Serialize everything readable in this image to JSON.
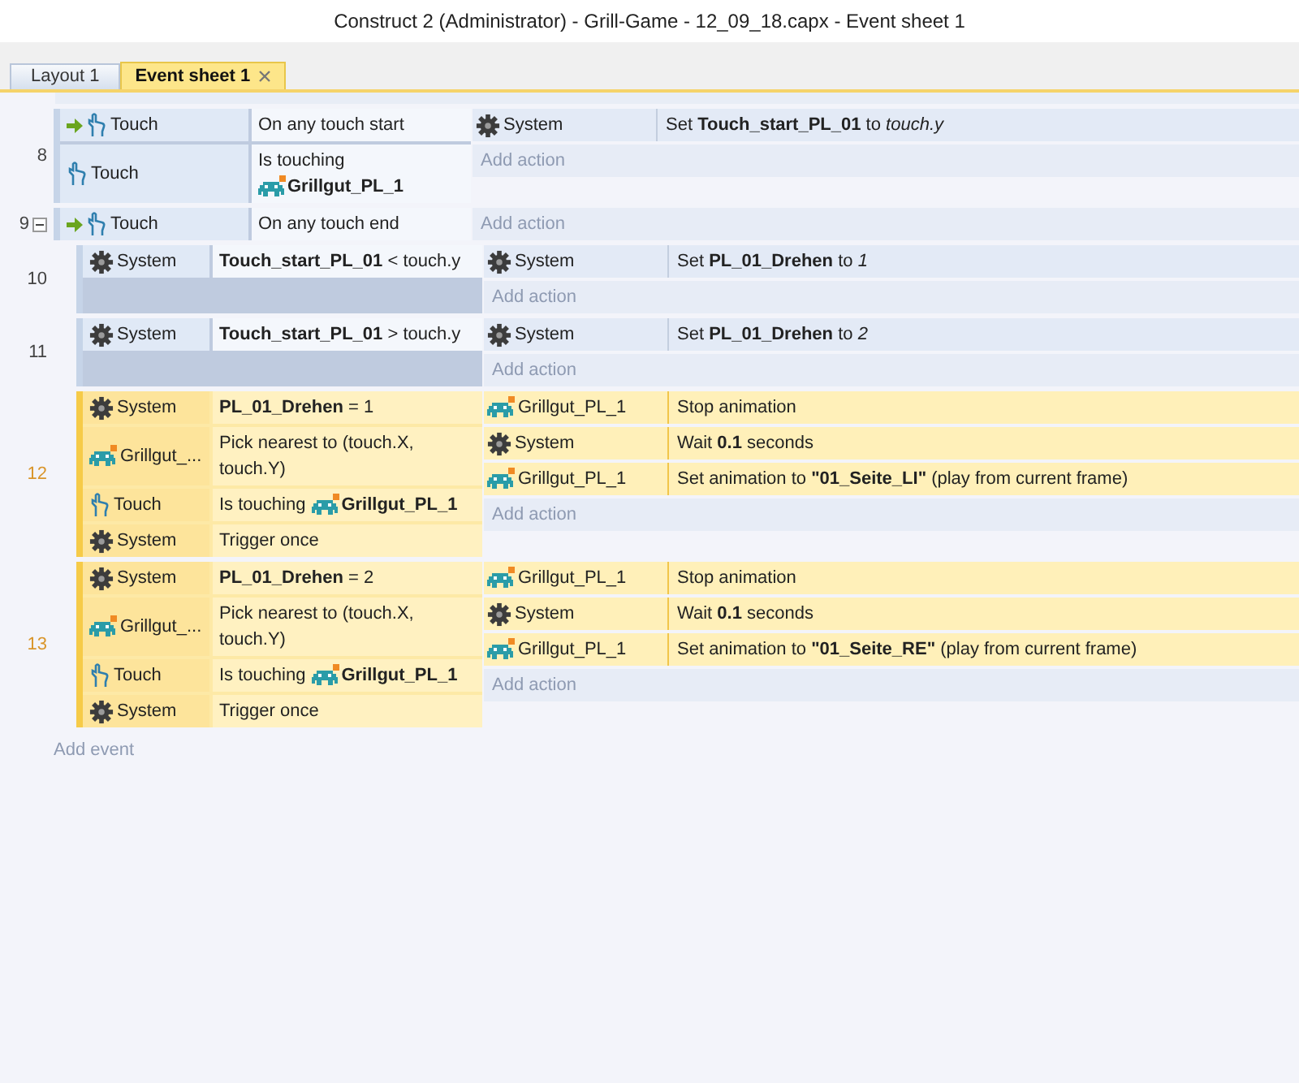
{
  "window": {
    "title": "Construct 2 (Administrator) - Grill-Game - 12_09_18.capx - Event sheet 1"
  },
  "tabs": [
    {
      "label": "Layout 1",
      "selected": false,
      "closable": false
    },
    {
      "label": "Event sheet 1",
      "selected": true,
      "closable": true
    }
  ],
  "events": [
    {
      "number": "8",
      "selected": false,
      "conditions": [
        {
          "object": "Touch",
          "kind": "touch",
          "trigger": true,
          "text": "On any touch start"
        },
        {
          "object": "Touch",
          "kind": "touch",
          "trigger": false,
          "text": "Is touching",
          "param": "Grillgut_PL_1"
        }
      ],
      "actions": [
        {
          "object": "System",
          "kind": "system",
          "text": "Set **Touch_start_PL_01** to *touch.y*"
        }
      ],
      "add_action": "Add action"
    },
    {
      "number": "9",
      "selected": false,
      "expanded": true,
      "conditions": [
        {
          "object": "Touch",
          "kind": "touch",
          "trigger": true,
          "text": "On any touch end"
        }
      ],
      "add_action": "Add action",
      "children": [
        {
          "number": "10",
          "selected": false,
          "conditions": [
            {
              "object": "System",
              "kind": "system",
              "trigger": false,
              "text": "**Touch_start_PL_01** < touch.y"
            }
          ],
          "actions": [
            {
              "object": "System",
              "kind": "system",
              "text": "Set **PL_01_Drehen** to *1*"
            }
          ],
          "add_action": "Add action"
        },
        {
          "number": "11",
          "selected": false,
          "conditions": [
            {
              "object": "System",
              "kind": "system",
              "trigger": false,
              "text": "**Touch_start_PL_01** > touch.y"
            }
          ],
          "actions": [
            {
              "object": "System",
              "kind": "system",
              "text": "Set **PL_01_Drehen** to *2*"
            }
          ],
          "add_action": "Add action"
        },
        {
          "number": "12",
          "selected": true,
          "conditions": [
            {
              "object": "System",
              "kind": "system",
              "trigger": false,
              "text": "**PL_01_Drehen** = 1"
            },
            {
              "object": "Grillgut_...",
              "kind": "sprite",
              "trigger": false,
              "text": "Pick nearest to (touch.X, touch.Y)"
            },
            {
              "object": "Touch",
              "kind": "touch",
              "trigger": false,
              "text": "Is touching",
              "param": "Grillgut_PL_1"
            },
            {
              "object": "System",
              "kind": "system",
              "trigger": false,
              "text": "Trigger once"
            }
          ],
          "actions": [
            {
              "object": "Grillgut_PL_1",
              "kind": "sprite",
              "text": "Stop animation"
            },
            {
              "object": "System",
              "kind": "system",
              "text": "Wait **0.1** seconds"
            },
            {
              "object": "Grillgut_PL_1",
              "kind": "sprite",
              "text": "Set animation to **\"01_Seite_LI\"** (play from current frame)"
            }
          ],
          "add_action": "Add action"
        },
        {
          "number": "13",
          "selected": true,
          "conditions": [
            {
              "object": "System",
              "kind": "system",
              "trigger": false,
              "text": "**PL_01_Drehen** = 2"
            },
            {
              "object": "Grillgut_...",
              "kind": "sprite",
              "trigger": false,
              "text": "Pick nearest to (touch.X, touch.Y)"
            },
            {
              "object": "Touch",
              "kind": "touch",
              "trigger": false,
              "text": "Is touching",
              "param": "Grillgut_PL_1"
            },
            {
              "object": "System",
              "kind": "system",
              "trigger": false,
              "text": "Trigger once"
            }
          ],
          "actions": [
            {
              "object": "Grillgut_PL_1",
              "kind": "sprite",
              "text": "Stop animation"
            },
            {
              "object": "System",
              "kind": "system",
              "text": "Wait **0.1** seconds"
            },
            {
              "object": "Grillgut_PL_1",
              "kind": "sprite",
              "text": "Set animation to **\"01_Seite_RE\"** (play from current frame)"
            }
          ],
          "add_action": "Add action"
        }
      ]
    }
  ],
  "add_event": "Add event"
}
